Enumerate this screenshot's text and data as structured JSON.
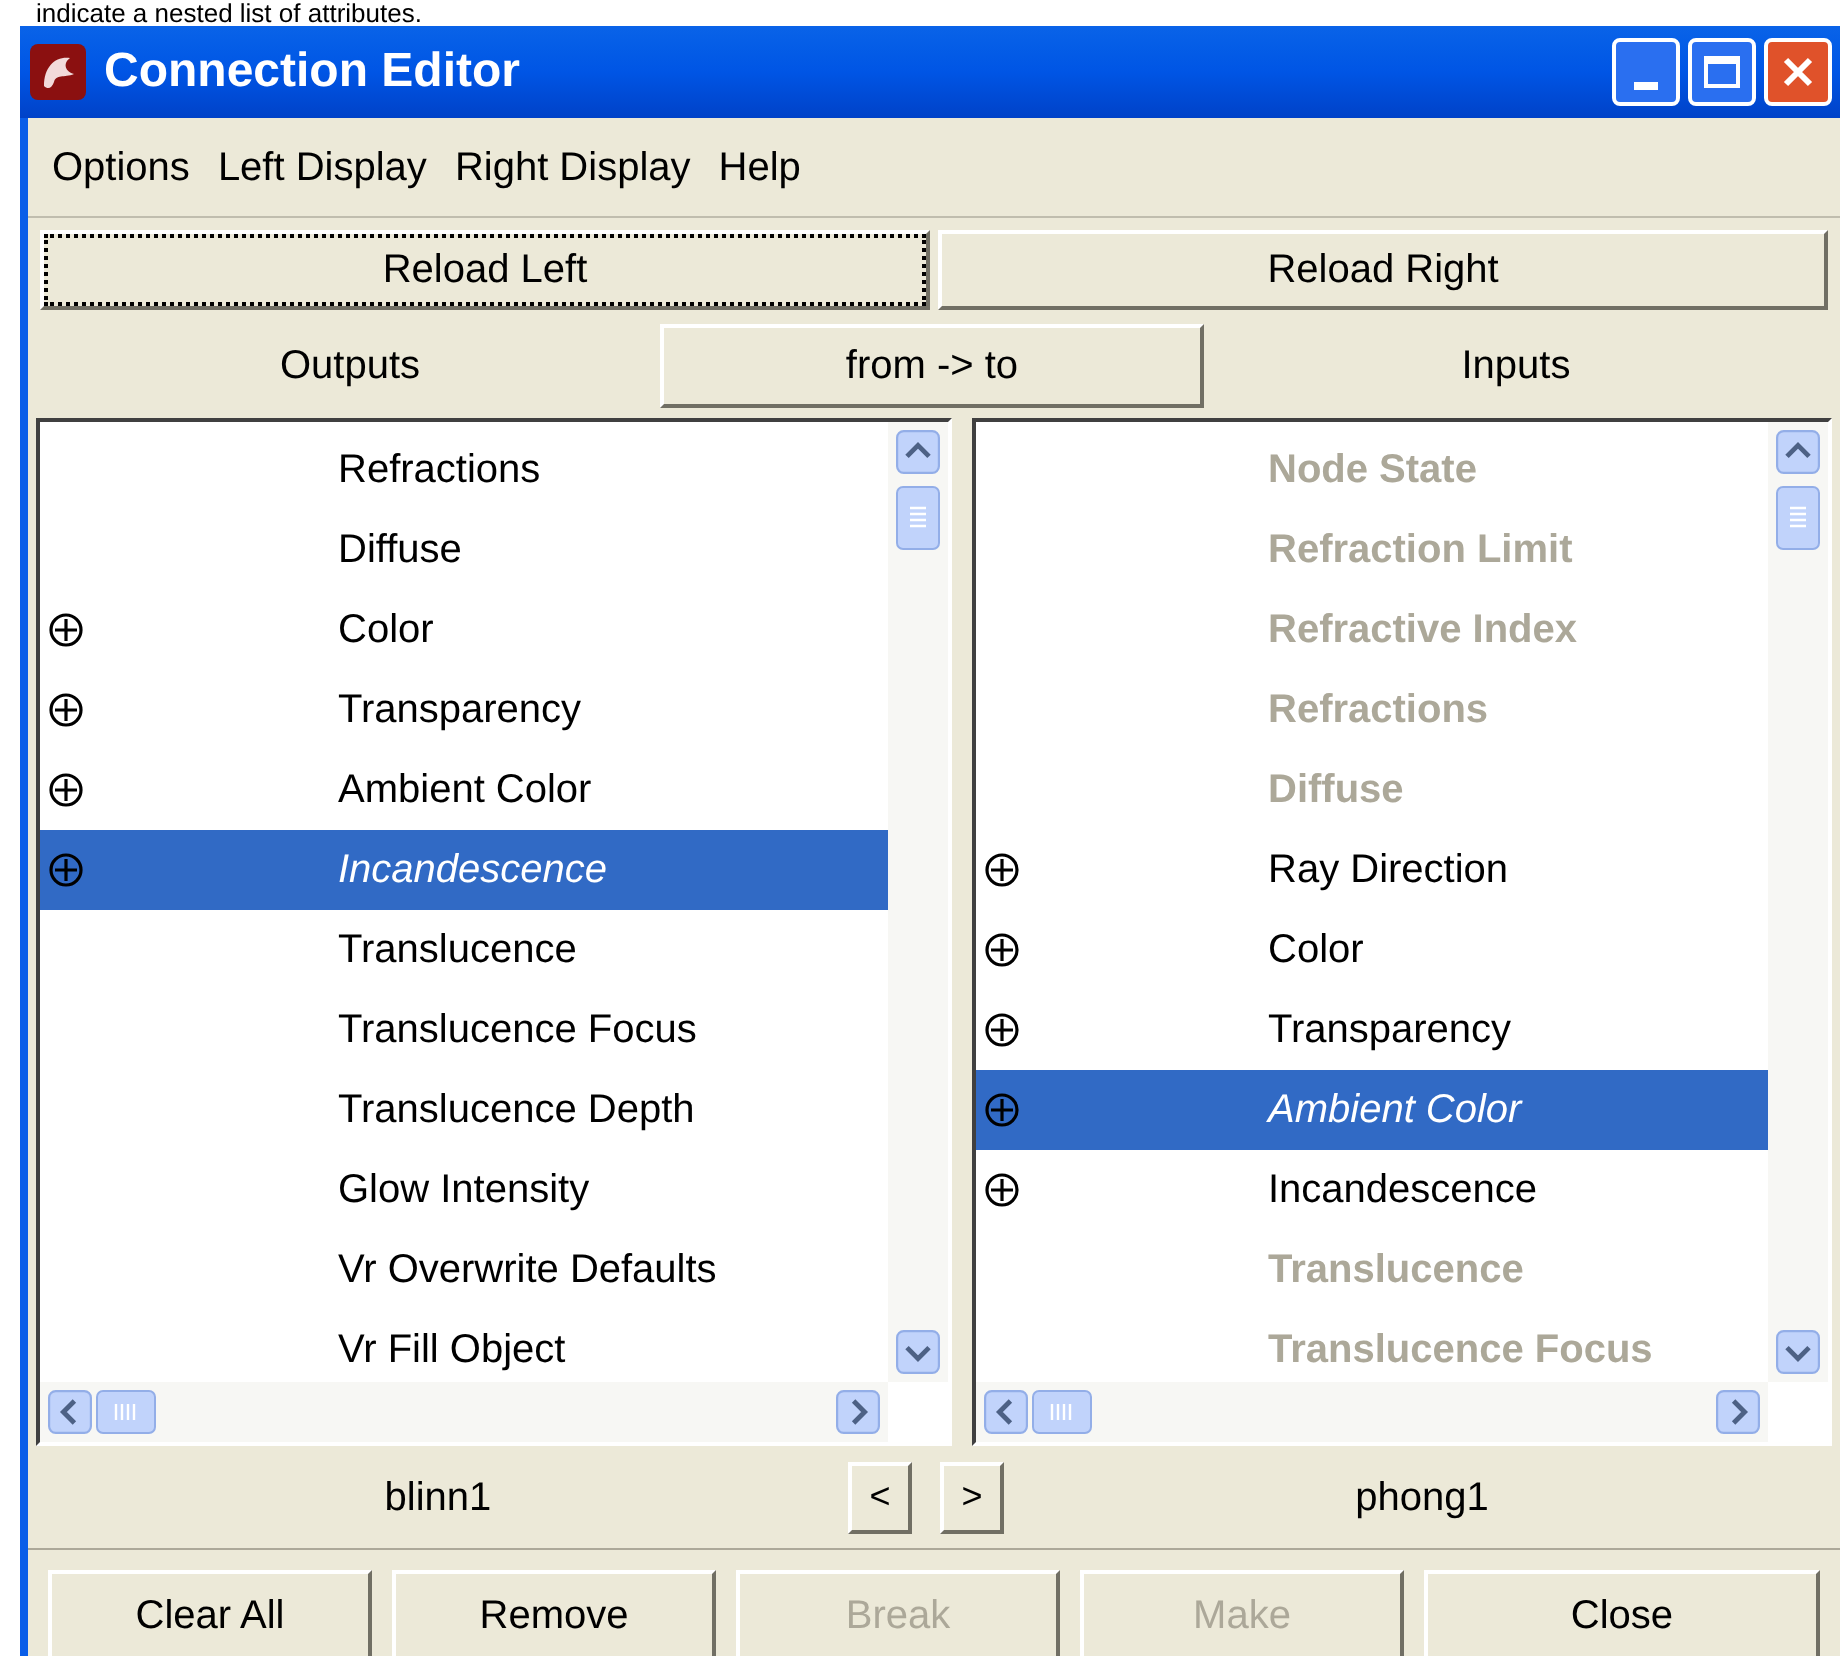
{
  "caption": "indicate a nested list of attributes.",
  "window": {
    "title": "Connection Editor"
  },
  "menu": [
    "Options",
    "Left Display",
    "Right Display",
    "Help"
  ],
  "reload_buttons": [
    {
      "label": "Reload Left",
      "focused": true
    },
    {
      "label": "Reload Right",
      "focused": false
    }
  ],
  "header": {
    "left": "Outputs",
    "toggle": "from -> to",
    "right": "Inputs"
  },
  "left_list": [
    {
      "label": "Refractions",
      "expandable": false,
      "kind": "normal",
      "selected": false
    },
    {
      "label": "Diffuse",
      "expandable": false,
      "kind": "normal",
      "selected": false
    },
    {
      "label": "Color",
      "expandable": true,
      "kind": "normal",
      "selected": false
    },
    {
      "label": "Transparency",
      "expandable": true,
      "kind": "normal",
      "selected": false
    },
    {
      "label": "Ambient Color",
      "expandable": true,
      "kind": "normal",
      "selected": false
    },
    {
      "label": "Incandescence",
      "expandable": true,
      "kind": "normal",
      "selected": true
    },
    {
      "label": "Translucence",
      "expandable": false,
      "kind": "normal",
      "selected": false
    },
    {
      "label": "Translucence Focus",
      "expandable": false,
      "kind": "normal",
      "selected": false
    },
    {
      "label": "Translucence Depth",
      "expandable": false,
      "kind": "normal",
      "selected": false
    },
    {
      "label": "Glow Intensity",
      "expandable": false,
      "kind": "normal",
      "selected": false
    },
    {
      "label": "Vr Overwrite Defaults",
      "expandable": false,
      "kind": "normal",
      "selected": false
    },
    {
      "label": "Vr Fill Object",
      "expandable": false,
      "kind": "normal",
      "selected": false
    }
  ],
  "right_list": [
    {
      "label": "Node State",
      "expandable": false,
      "kind": "dimmed",
      "selected": false
    },
    {
      "label": "Refraction Limit",
      "expandable": false,
      "kind": "dimmed",
      "selected": false
    },
    {
      "label": "Refractive Index",
      "expandable": false,
      "kind": "dimmed",
      "selected": false
    },
    {
      "label": "Refractions",
      "expandable": false,
      "kind": "dimmed",
      "selected": false
    },
    {
      "label": "Diffuse",
      "expandable": false,
      "kind": "dimmed",
      "selected": false
    },
    {
      "label": "Ray Direction",
      "expandable": true,
      "kind": "normal",
      "selected": false
    },
    {
      "label": "Color",
      "expandable": true,
      "kind": "normal",
      "selected": false
    },
    {
      "label": "Transparency",
      "expandable": true,
      "kind": "normal",
      "selected": false
    },
    {
      "label": "Ambient Color",
      "expandable": true,
      "kind": "normal",
      "selected": true
    },
    {
      "label": "Incandescence",
      "expandable": true,
      "kind": "normal",
      "selected": false
    },
    {
      "label": "Translucence",
      "expandable": false,
      "kind": "dimmed",
      "selected": false
    },
    {
      "label": "Translucence Focus",
      "expandable": false,
      "kind": "dimmed",
      "selected": false
    }
  ],
  "nodes": {
    "left": "blinn1",
    "prev": "<",
    "next": ">",
    "right": "phong1"
  },
  "buttons": [
    {
      "label": "Clear All",
      "disabled": false
    },
    {
      "label": "Remove",
      "disabled": false
    },
    {
      "label": "Break",
      "disabled": true
    },
    {
      "label": "Make",
      "disabled": true
    },
    {
      "label": "Close",
      "disabled": false
    }
  ]
}
